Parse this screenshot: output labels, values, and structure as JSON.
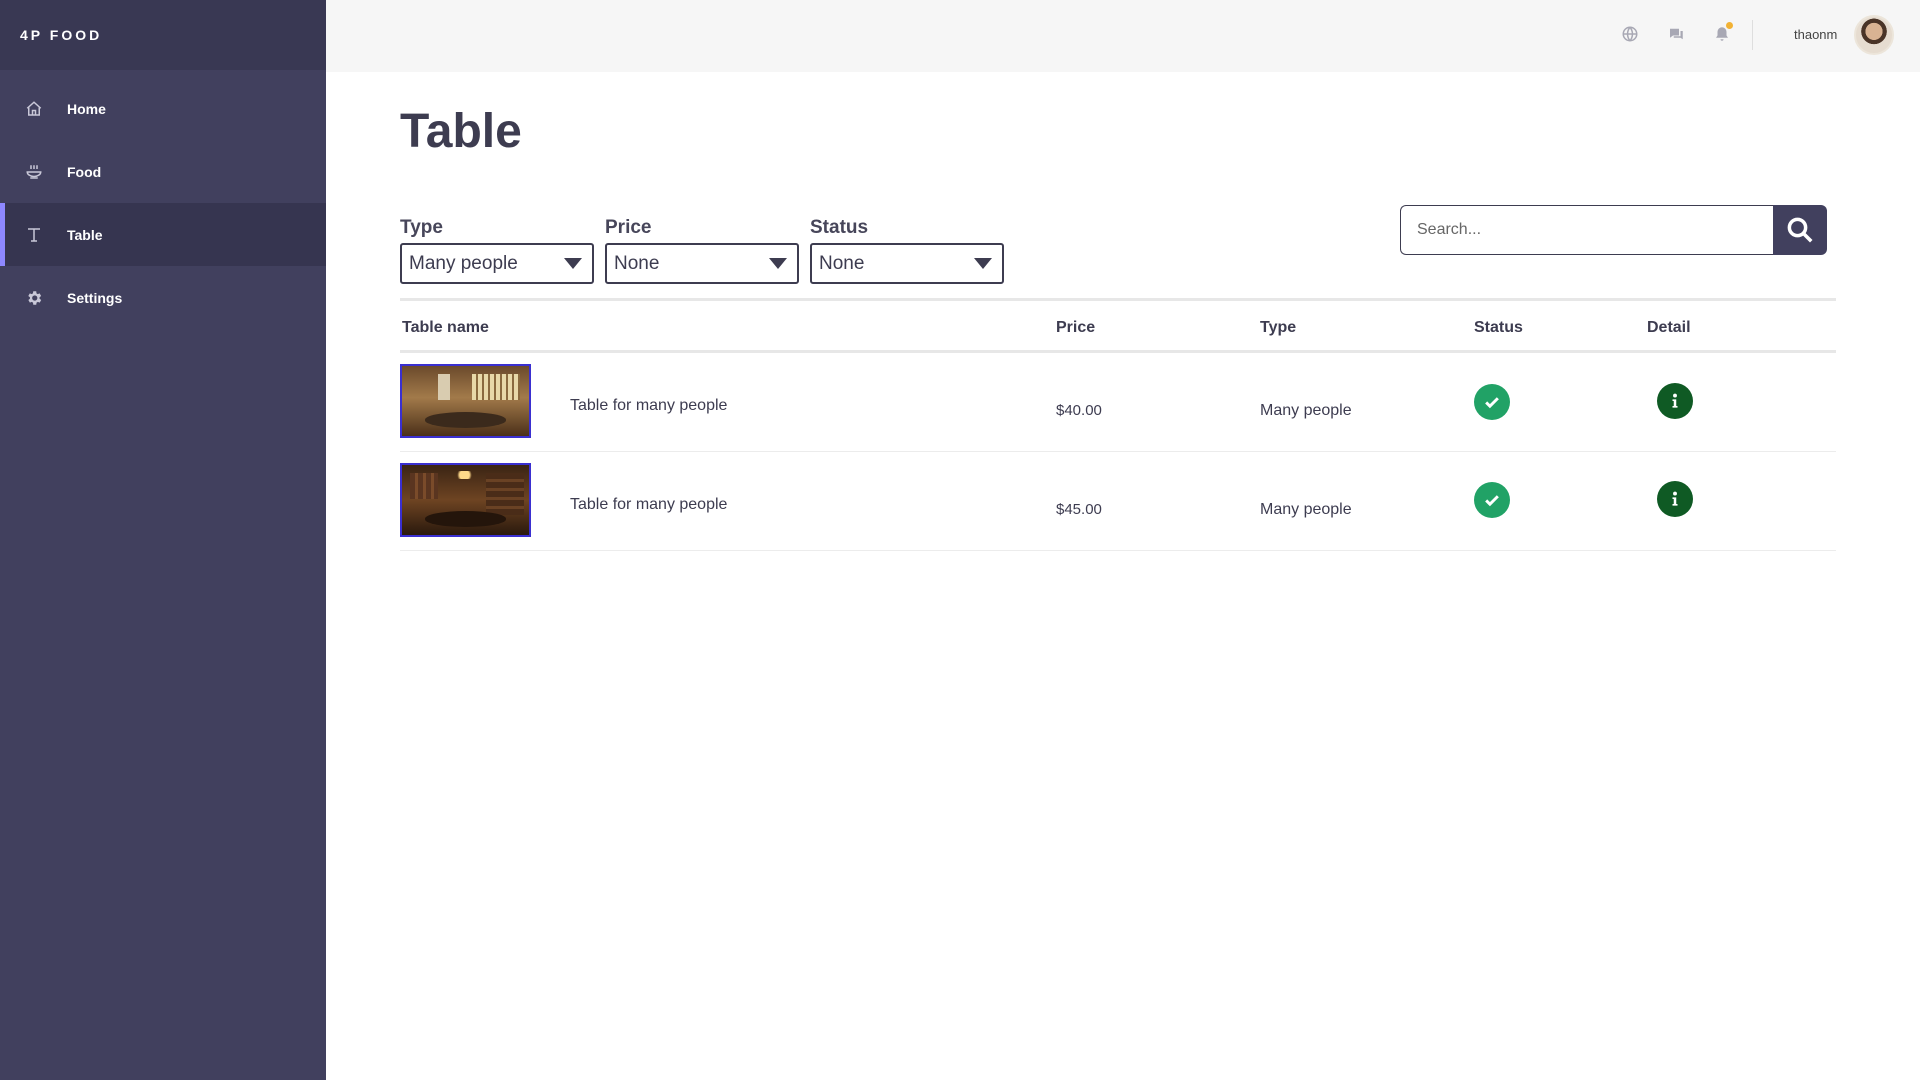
{
  "app": {
    "brand": "4P FOOD"
  },
  "sidebar": {
    "items": [
      {
        "label": "Home",
        "icon": "home-icon",
        "active": false
      },
      {
        "label": "Food",
        "icon": "food-bowl-icon",
        "active": false
      },
      {
        "label": "Table",
        "icon": "table-icon",
        "active": true
      },
      {
        "label": "Settings",
        "icon": "gear-icon",
        "active": false
      }
    ]
  },
  "topbar": {
    "username": "thaonm",
    "icons": [
      "globe-icon",
      "chat-icon",
      "bell-icon"
    ]
  },
  "page": {
    "title": "Table"
  },
  "filters": {
    "type": {
      "label": "Type",
      "value": "Many people"
    },
    "price": {
      "label": "Price",
      "value": "None"
    },
    "status": {
      "label": "Status",
      "value": "None"
    }
  },
  "search": {
    "placeholder": "Search..."
  },
  "table": {
    "columns": {
      "name": "Table name",
      "price": "Price",
      "type": "Type",
      "status": "Status",
      "detail": "Detail"
    },
    "rows": [
      {
        "name": "Table for many people",
        "price": "$40.00",
        "type": "Many people",
        "status": "available"
      },
      {
        "name": "Table for many people",
        "price": "$45.00",
        "type": "Many people",
        "status": "available"
      }
    ]
  },
  "colors": {
    "sidebar": "#41405e",
    "accent": "#8e88ff",
    "status_ok": "#21a266",
    "detail": "#0f5a24",
    "notification": "#f2b234"
  }
}
